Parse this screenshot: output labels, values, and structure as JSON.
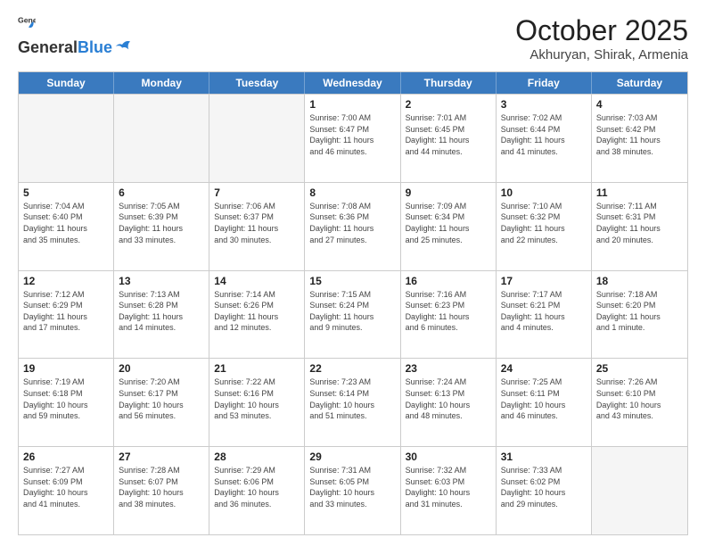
{
  "header": {
    "logo_general": "General",
    "logo_blue": "Blue",
    "month": "October 2025",
    "location": "Akhuryan, Shirak, Armenia"
  },
  "weekdays": [
    "Sunday",
    "Monday",
    "Tuesday",
    "Wednesday",
    "Thursday",
    "Friday",
    "Saturday"
  ],
  "weeks": [
    [
      {
        "day": "",
        "info": ""
      },
      {
        "day": "",
        "info": ""
      },
      {
        "day": "",
        "info": ""
      },
      {
        "day": "1",
        "info": "Sunrise: 7:00 AM\nSunset: 6:47 PM\nDaylight: 11 hours\nand 46 minutes."
      },
      {
        "day": "2",
        "info": "Sunrise: 7:01 AM\nSunset: 6:45 PM\nDaylight: 11 hours\nand 44 minutes."
      },
      {
        "day": "3",
        "info": "Sunrise: 7:02 AM\nSunset: 6:44 PM\nDaylight: 11 hours\nand 41 minutes."
      },
      {
        "day": "4",
        "info": "Sunrise: 7:03 AM\nSunset: 6:42 PM\nDaylight: 11 hours\nand 38 minutes."
      }
    ],
    [
      {
        "day": "5",
        "info": "Sunrise: 7:04 AM\nSunset: 6:40 PM\nDaylight: 11 hours\nand 35 minutes."
      },
      {
        "day": "6",
        "info": "Sunrise: 7:05 AM\nSunset: 6:39 PM\nDaylight: 11 hours\nand 33 minutes."
      },
      {
        "day": "7",
        "info": "Sunrise: 7:06 AM\nSunset: 6:37 PM\nDaylight: 11 hours\nand 30 minutes."
      },
      {
        "day": "8",
        "info": "Sunrise: 7:08 AM\nSunset: 6:36 PM\nDaylight: 11 hours\nand 27 minutes."
      },
      {
        "day": "9",
        "info": "Sunrise: 7:09 AM\nSunset: 6:34 PM\nDaylight: 11 hours\nand 25 minutes."
      },
      {
        "day": "10",
        "info": "Sunrise: 7:10 AM\nSunset: 6:32 PM\nDaylight: 11 hours\nand 22 minutes."
      },
      {
        "day": "11",
        "info": "Sunrise: 7:11 AM\nSunset: 6:31 PM\nDaylight: 11 hours\nand 20 minutes."
      }
    ],
    [
      {
        "day": "12",
        "info": "Sunrise: 7:12 AM\nSunset: 6:29 PM\nDaylight: 11 hours\nand 17 minutes."
      },
      {
        "day": "13",
        "info": "Sunrise: 7:13 AM\nSunset: 6:28 PM\nDaylight: 11 hours\nand 14 minutes."
      },
      {
        "day": "14",
        "info": "Sunrise: 7:14 AM\nSunset: 6:26 PM\nDaylight: 11 hours\nand 12 minutes."
      },
      {
        "day": "15",
        "info": "Sunrise: 7:15 AM\nSunset: 6:24 PM\nDaylight: 11 hours\nand 9 minutes."
      },
      {
        "day": "16",
        "info": "Sunrise: 7:16 AM\nSunset: 6:23 PM\nDaylight: 11 hours\nand 6 minutes."
      },
      {
        "day": "17",
        "info": "Sunrise: 7:17 AM\nSunset: 6:21 PM\nDaylight: 11 hours\nand 4 minutes."
      },
      {
        "day": "18",
        "info": "Sunrise: 7:18 AM\nSunset: 6:20 PM\nDaylight: 11 hours\nand 1 minute."
      }
    ],
    [
      {
        "day": "19",
        "info": "Sunrise: 7:19 AM\nSunset: 6:18 PM\nDaylight: 10 hours\nand 59 minutes."
      },
      {
        "day": "20",
        "info": "Sunrise: 7:20 AM\nSunset: 6:17 PM\nDaylight: 10 hours\nand 56 minutes."
      },
      {
        "day": "21",
        "info": "Sunrise: 7:22 AM\nSunset: 6:16 PM\nDaylight: 10 hours\nand 53 minutes."
      },
      {
        "day": "22",
        "info": "Sunrise: 7:23 AM\nSunset: 6:14 PM\nDaylight: 10 hours\nand 51 minutes."
      },
      {
        "day": "23",
        "info": "Sunrise: 7:24 AM\nSunset: 6:13 PM\nDaylight: 10 hours\nand 48 minutes."
      },
      {
        "day": "24",
        "info": "Sunrise: 7:25 AM\nSunset: 6:11 PM\nDaylight: 10 hours\nand 46 minutes."
      },
      {
        "day": "25",
        "info": "Sunrise: 7:26 AM\nSunset: 6:10 PM\nDaylight: 10 hours\nand 43 minutes."
      }
    ],
    [
      {
        "day": "26",
        "info": "Sunrise: 7:27 AM\nSunset: 6:09 PM\nDaylight: 10 hours\nand 41 minutes."
      },
      {
        "day": "27",
        "info": "Sunrise: 7:28 AM\nSunset: 6:07 PM\nDaylight: 10 hours\nand 38 minutes."
      },
      {
        "day": "28",
        "info": "Sunrise: 7:29 AM\nSunset: 6:06 PM\nDaylight: 10 hours\nand 36 minutes."
      },
      {
        "day": "29",
        "info": "Sunrise: 7:31 AM\nSunset: 6:05 PM\nDaylight: 10 hours\nand 33 minutes."
      },
      {
        "day": "30",
        "info": "Sunrise: 7:32 AM\nSunset: 6:03 PM\nDaylight: 10 hours\nand 31 minutes."
      },
      {
        "day": "31",
        "info": "Sunrise: 7:33 AM\nSunset: 6:02 PM\nDaylight: 10 hours\nand 29 minutes."
      },
      {
        "day": "",
        "info": ""
      }
    ]
  ]
}
